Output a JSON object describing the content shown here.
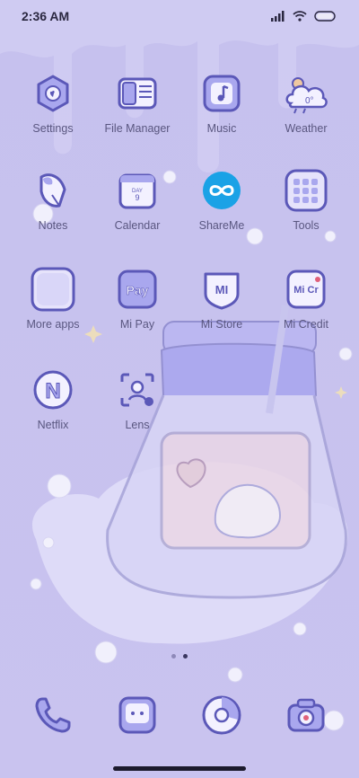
{
  "status_bar": {
    "time": "2:36 AM",
    "icons": [
      "signal-icon",
      "wifi-icon",
      "battery-icon"
    ]
  },
  "apps": [
    {
      "label": "Settings",
      "icon": "settings-icon"
    },
    {
      "label": "File Manager",
      "icon": "file-manager-icon"
    },
    {
      "label": "Music",
      "icon": "music-icon"
    },
    {
      "label": "Weather",
      "icon": "weather-icon",
      "icon_text": "0°"
    },
    {
      "label": "Notes",
      "icon": "notes-icon"
    },
    {
      "label": "Calendar",
      "icon": "calendar-icon",
      "icon_text": "DAY",
      "icon_day": "9"
    },
    {
      "label": "ShareMe",
      "icon": "shareme-icon"
    },
    {
      "label": "Tools",
      "icon": "tools-folder-icon"
    },
    {
      "label": "More apps",
      "icon": "more-apps-folder-icon"
    },
    {
      "label": "Mi Pay",
      "icon": "mi-pay-icon",
      "icon_text": "Pay"
    },
    {
      "label": "Mi Store",
      "icon": "mi-store-icon",
      "icon_text": "MI"
    },
    {
      "label": "Mi Credit",
      "icon": "mi-credit-icon",
      "icon_text": "Mi Cr"
    },
    {
      "label": "Netflix",
      "icon": "netflix-icon",
      "icon_text": "N"
    },
    {
      "label": "Lens",
      "icon": "lens-icon"
    }
  ],
  "page_indicator": {
    "pages": 2,
    "current": 2
  },
  "dock": [
    {
      "icon": "phone-icon"
    },
    {
      "icon": "messaging-icon"
    },
    {
      "icon": "browser-icon"
    },
    {
      "icon": "camera-icon"
    }
  ],
  "colors": {
    "background": "#c9c4ef",
    "icon_fill": "#a9a7ee",
    "icon_outline": "#5b58b8",
    "label": "#5a5780",
    "shareme_blue": "#1aa2e6"
  }
}
